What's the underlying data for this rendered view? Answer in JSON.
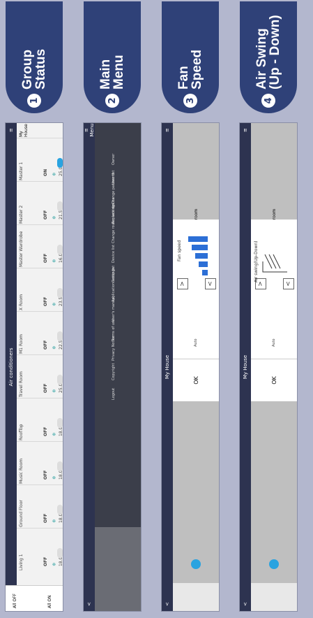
{
  "panels": [
    {
      "number": "1",
      "label_lines": [
        "Group",
        "Status"
      ]
    },
    {
      "number": "2",
      "label_lines": [
        "Main",
        "Menu"
      ]
    },
    {
      "number": "3",
      "label_lines": [
        "Fan",
        "Speed"
      ]
    },
    {
      "number": "4",
      "label_lines": [
        "Air Swing",
        "(Up - Down)"
      ]
    }
  ],
  "group": {
    "title": "Air conditioners",
    "section": "My House",
    "units": [
      {
        "name": "Master 1",
        "state": "ON",
        "temp": "25.0℃",
        "on": true
      },
      {
        "name": "Master 2",
        "state": "OFF",
        "temp": "21.5℃",
        "on": false
      },
      {
        "name": "Master Wardrobe",
        "state": "OFF",
        "temp": "16.0℃",
        "on": false
      },
      {
        "name": "X Room",
        "state": "OFF",
        "temp": "23.5℃",
        "on": false
      },
      {
        "name": "M1 Room",
        "state": "OFF",
        "temp": "22.5℃",
        "on": false
      },
      {
        "name": "Travel Room",
        "state": "OFF",
        "temp": "25.0℃",
        "on": false
      },
      {
        "name": "RoofTop",
        "state": "OFF",
        "temp": "18.0℃",
        "on": false
      },
      {
        "name": "Music Room",
        "state": "OFF",
        "temp": "18.0℃",
        "on": false
      },
      {
        "name": "Ground Floor",
        "state": "OFF",
        "temp": "18.0℃",
        "on": false
      },
      {
        "name": "Living 1",
        "state": "OFF",
        "temp": "18.0℃",
        "on": false
      }
    ],
    "all_off": "All OFF",
    "all_on": "All ON"
  },
  "menu": {
    "header": "Menu",
    "items": [
      "Owner",
      "User list",
      "Change password",
      "Replace device",
      "Change router settings",
      "Device list",
      "Group list",
      "Application settings",
      "User's manual",
      "Terms of use",
      "Privacy Notice",
      "Copyright",
      "Logout"
    ]
  },
  "fan": {
    "title": "My House",
    "room": "Living room",
    "dialog_title": "Fan speed",
    "auto": "Auto",
    "ok": "OK",
    "level_of_5": 5
  },
  "swing": {
    "title": "My House",
    "room": "Living room",
    "dialog_title": "Air swing(Up-Down)",
    "auto": "Auto",
    "ok": "OK"
  }
}
